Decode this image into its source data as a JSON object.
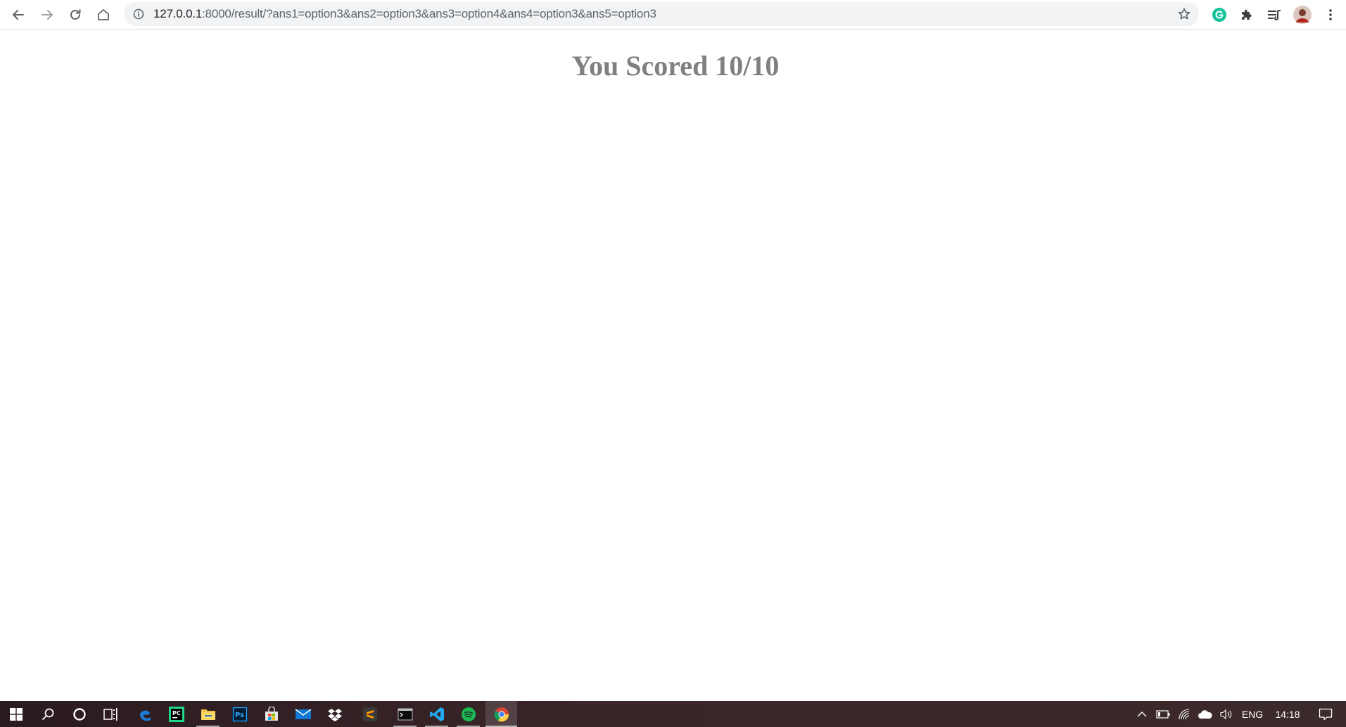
{
  "browser": {
    "url_host": "127.0.0.1",
    "url_rest": ":8000/result/?ans1=option3&ans2=option3&ans3=option4&ans4=option3&ans5=option3",
    "icons": {
      "back": "arrow-left-icon",
      "forward": "arrow-right-icon",
      "reload": "reload-icon",
      "home": "home-icon",
      "site_info": "info-icon",
      "bookmark": "star-icon",
      "grammarly": "grammarly-icon",
      "extensions": "puzzle-icon",
      "reading_list": "reading-list-icon",
      "profile": "avatar",
      "menu": "kebab-menu-icon"
    }
  },
  "page": {
    "heading": "You Scored 10/10"
  },
  "taskbar": {
    "apps": [
      {
        "name": "windows-start-icon"
      },
      {
        "name": "search-icon"
      },
      {
        "name": "cortana-icon"
      },
      {
        "name": "task-view-icon"
      },
      {
        "name": "edge-icon"
      },
      {
        "name": "pycharm-icon"
      },
      {
        "name": "file-explorer-icon"
      },
      {
        "name": "photoshop-icon"
      },
      {
        "name": "store-icon"
      },
      {
        "name": "mail-icon"
      },
      {
        "name": "dropbox-icon"
      },
      {
        "name": "sublime-text-icon"
      },
      {
        "name": "terminal-icon"
      },
      {
        "name": "vscode-icon"
      },
      {
        "name": "spotify-icon"
      },
      {
        "name": "chrome-icon"
      }
    ],
    "tray": {
      "language": "ENG",
      "time": "14:18"
    }
  },
  "colors": {
    "heading": "#808080",
    "omnibox_bg": "#f1f3f4",
    "taskbar_bg": "#3a2629"
  }
}
